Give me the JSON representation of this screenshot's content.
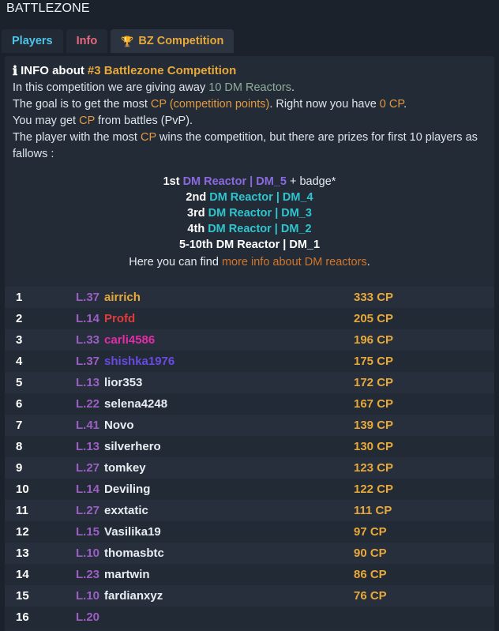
{
  "site": {
    "title": "BATTLEZONE"
  },
  "tabs": [
    {
      "label": "Players",
      "icon": null,
      "active": false
    },
    {
      "label": "Info",
      "icon": null,
      "active": false
    },
    {
      "label": "BZ Competition",
      "icon": "trophy-icon",
      "active": true
    }
  ],
  "info": {
    "icon": "info-icon",
    "heading_label": "INFO about",
    "heading_accent": "#3 Battlezone Competition",
    "line1_a": "In this competition we are giving away ",
    "line1_b": "10 DM Reactors",
    "line1_c": ".",
    "line2_a": "The goal is to get the most ",
    "line2_b": "CP (competition points)",
    "line2_c": ". Right now you have ",
    "line2_d": "0 CP",
    "line2_e": ".",
    "line3_a": "You may get ",
    "line3_b": "CP",
    "line3_c": " from battles (PvP).",
    "line4_a": "The player with the most ",
    "line4_b": "CP",
    "line4_c": " wins the competition, but there are prizes for first 10 players as fallows :"
  },
  "prizes": [
    {
      "rank": "1st",
      "item": "DM Reactor | DM_5",
      "extra": " + badge*",
      "color": "#8b6ae0"
    },
    {
      "rank": "2nd",
      "item": "DM Reactor | DM_4",
      "extra": "",
      "color": "#2fc5cf"
    },
    {
      "rank": "3rd",
      "item": "DM Reactor | DM_3",
      "extra": "",
      "color": "#2fc5cf"
    },
    {
      "rank": "4th",
      "item": "DM Reactor | DM_2",
      "extra": "",
      "color": "#2fc5cf"
    },
    {
      "rank": "5-10th",
      "item": "DM Reactor | DM_1",
      "extra": "",
      "color": "#ffffff"
    }
  ],
  "more_info": {
    "prefix": "Here you can find ",
    "link": "more info about DM reactors",
    "suffix": "."
  },
  "leaderboard": {
    "rows": [
      {
        "rank": "1",
        "level": "L.37",
        "name": "airrich",
        "name_color": "#e8a93a",
        "cp": "333 CP"
      },
      {
        "rank": "2",
        "level": "L.14",
        "name": "Profd",
        "name_color": "#e03c3c",
        "cp": "205 CP"
      },
      {
        "rank": "3",
        "level": "L.33",
        "name": "carli4586",
        "name_color": "#e42ba8",
        "cp": "196 CP"
      },
      {
        "rank": "4",
        "level": "L.37",
        "name": "shishka1976",
        "name_color": "#6a4ae0",
        "cp": "175 CP"
      },
      {
        "rank": "5",
        "level": "L.13",
        "name": "lior353",
        "name_color": "#e8edf2",
        "cp": "172 CP"
      },
      {
        "rank": "6",
        "level": "L.22",
        "name": "selena4248",
        "name_color": "#e8edf2",
        "cp": "167 CP"
      },
      {
        "rank": "7",
        "level": "L.41",
        "name": "Novo",
        "name_color": "#e8edf2",
        "cp": "139 CP"
      },
      {
        "rank": "8",
        "level": "L.13",
        "name": "silverhero",
        "name_color": "#e8edf2",
        "cp": "130 CP"
      },
      {
        "rank": "9",
        "level": "L.27",
        "name": "tomkey",
        "name_color": "#e8edf2",
        "cp": "123 CP"
      },
      {
        "rank": "10",
        "level": "L.14",
        "name": "Deviling",
        "name_color": "#e8edf2",
        "cp": "122 CP"
      },
      {
        "rank": "11",
        "level": "L.27",
        "name": "exxtatic",
        "name_color": "#e8edf2",
        "cp": "111 CP"
      },
      {
        "rank": "12",
        "level": "L.15",
        "name": "Vasilika19",
        "name_color": "#e8edf2",
        "cp": "97 CP"
      },
      {
        "rank": "13",
        "level": "L.10",
        "name": "thomasbtc",
        "name_color": "#e8edf2",
        "cp": "90 CP"
      },
      {
        "rank": "14",
        "level": "L.23",
        "name": "martwin",
        "name_color": "#e8edf2",
        "cp": "86 CP"
      },
      {
        "rank": "15",
        "level": "L.10",
        "name": "fardianxyz",
        "name_color": "#e8edf2",
        "cp": "76 CP"
      },
      {
        "rank": "16",
        "level": "L.20",
        "name": "",
        "name_color": "#e8edf2",
        "cp": ""
      }
    ]
  },
  "colors": {
    "page_bg": "#1b222c",
    "panel_bg": "#232b36",
    "accent_orange": "#e8a93a",
    "accent_cyan": "#4dc4e8",
    "accent_pink": "#e8687f",
    "level_purple": "#9b5fc4",
    "link_orange": "#d2762c"
  }
}
